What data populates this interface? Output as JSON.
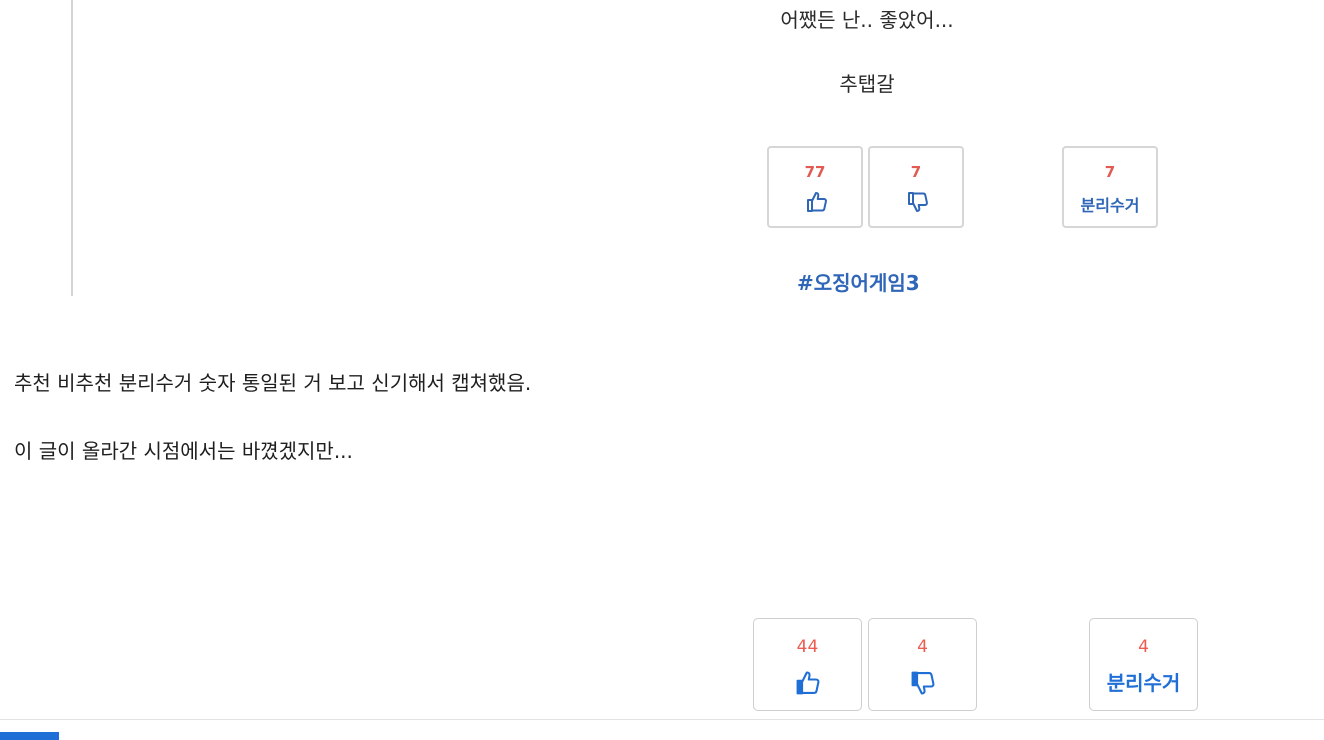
{
  "embedded_post": {
    "lines": [
      "어쨌든 난.. 좋았어...",
      "추탭갈"
    ],
    "buttons": {
      "upvote_count": "77",
      "downvote_count": "7",
      "recycle_count": "7",
      "recycle_label": "분리수거"
    },
    "hashtag": "#오징어게임3"
  },
  "post_body": {
    "paragraphs": [
      "추천 비추천 분리수거 숫자 통일된 거 보고 신기해서 캡쳐했음.",
      "이 글이 올라간 시점에서는 바꼈겠지만..."
    ]
  },
  "vote_bar": {
    "upvote_count": "44",
    "downvote_count": "4",
    "recycle_count": "4",
    "recycle_label": "분리수거"
  },
  "colors": {
    "count_red": "#ec5c50",
    "accent_blue": "#1f6fd6"
  },
  "icons": [
    "thumbs-up-icon",
    "thumbs-down-icon"
  ]
}
